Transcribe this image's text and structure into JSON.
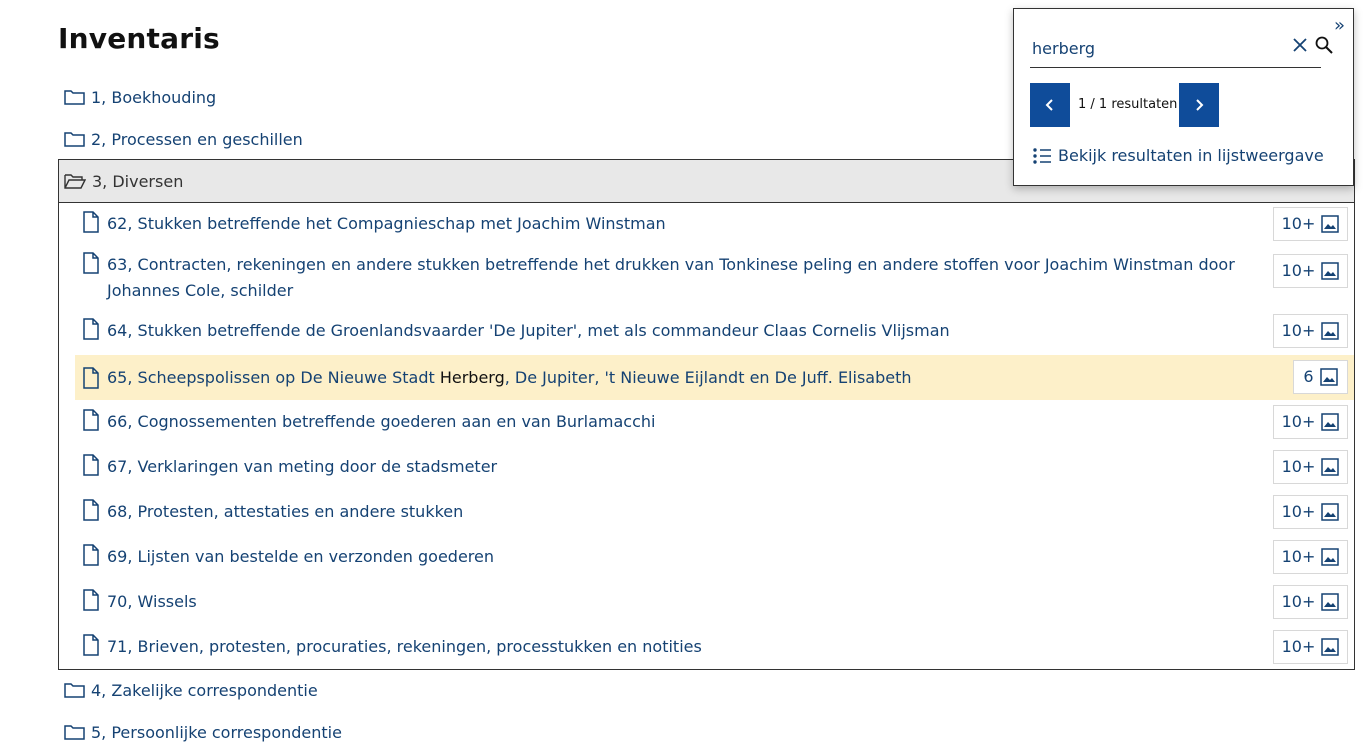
{
  "page": {
    "title": "Inventaris"
  },
  "folders_top": [
    {
      "label": "1, Boekhouding"
    },
    {
      "label": "2, Processen en geschillen"
    }
  ],
  "open_folder": {
    "label": "3, Diversen",
    "items": [
      {
        "text": "62, Stukken betreffende het Compagnieschap met Joachim Winstman",
        "count": "10+"
      },
      {
        "text": "63, Contracten, rekeningen en andere stukken betreffende het drukken van Tonkinese peling en andere stoffen voor Joachim Winstman door Johannes Cole, schilder",
        "count": "10+"
      },
      {
        "text": "64, Stukken betreffende de Groenlandsvaarder 'De Jupiter', met als commandeur Claas Cornelis Vlijsman",
        "count": "10+"
      },
      {
        "text_before": "65, Scheepspolissen op De Nieuwe Stadt ",
        "text_match": "Herberg",
        "text_after": ", De Jupiter, 't Nieuwe Eijlandt en De Juff. Elisabeth",
        "count": "6",
        "highlighted": true
      },
      {
        "text": "66, Cognossementen betreffende goederen aan en van Burlamacchi",
        "count": "10+"
      },
      {
        "text": "67, Verklaringen van meting door de stadsmeter",
        "count": "10+"
      },
      {
        "text": "68, Protesten, attestaties en andere stukken",
        "count": "10+"
      },
      {
        "text": "69, Lijsten van bestelde en verzonden goederen",
        "count": "10+"
      },
      {
        "text": "70, Wissels",
        "count": "10+"
      },
      {
        "text": "71, Brieven, protesten, procuraties, rekeningen, processtukken en notities",
        "count": "10+"
      }
    ]
  },
  "folders_bottom": [
    {
      "label": "4, Zakelijke correspondentie"
    },
    {
      "label": "5, Persoonlijke correspondentie"
    }
  ],
  "search": {
    "collapse_label": "»",
    "query": "herberg",
    "result_count": "1 / 1 resultaten",
    "list_view_label": "Bekijk resultaten in lijstweergave"
  },
  "colors": {
    "link": "#154273",
    "accent": "#0f4c9a",
    "highlight": "#fdf0c9",
    "header_bg": "#e8e8e8"
  },
  "icons": [
    "folder-icon",
    "folder-open-icon",
    "document-icon",
    "image-icon",
    "close-icon",
    "search-icon",
    "chevron-left-icon",
    "chevron-right-icon",
    "list-icon",
    "double-chevron-right-icon"
  ]
}
